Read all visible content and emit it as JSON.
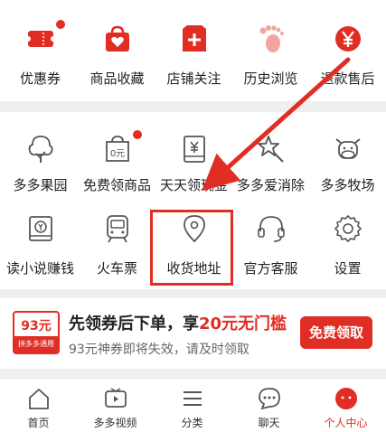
{
  "colors": {
    "brand": "#e02e24",
    "text": "#222222",
    "muted": "#666666"
  },
  "top_row": [
    {
      "label": "优惠券",
      "icon": "coupon-icon"
    },
    {
      "label": "商品收藏",
      "icon": "bag-heart-icon"
    },
    {
      "label": "店铺关注",
      "icon": "store-plus-icon"
    },
    {
      "label": "历史浏览",
      "icon": "footprint-icon"
    },
    {
      "label": "退款售后",
      "icon": "yen-circle-icon"
    }
  ],
  "grid_row1": [
    {
      "label": "多多果园",
      "icon": "tree-icon"
    },
    {
      "label": "免费领商品",
      "icon": "zero-yuan-icon"
    },
    {
      "label": "天天领现金",
      "icon": "cash-envelope-icon"
    },
    {
      "label": "多多爱消除",
      "icon": "star-wand-icon"
    },
    {
      "label": "多多牧场",
      "icon": "cow-icon"
    }
  ],
  "grid_row2": [
    {
      "label": "读小说赚钱",
      "icon": "book-coin-icon"
    },
    {
      "label": "火车票",
      "icon": "train-icon"
    },
    {
      "label": "收货地址",
      "icon": "location-pin-icon"
    },
    {
      "label": "官方客服",
      "icon": "headset-icon"
    },
    {
      "label": "设置",
      "icon": "gear-icon"
    }
  ],
  "promo": {
    "badge_amount": "93元",
    "badge_sub": "拼多多通用",
    "title_a": "先领券后下单，享",
    "title_hl": "20元无门槛",
    "subtitle": "93元神券即将失效，请及时领取",
    "button": "免费领取"
  },
  "tabs": [
    {
      "label": "首页",
      "icon": "home-icon"
    },
    {
      "label": "多多视频",
      "icon": "video-icon"
    },
    {
      "label": "分类",
      "icon": "list-icon"
    },
    {
      "label": "聊天",
      "icon": "chat-icon"
    },
    {
      "label": "个人中心",
      "icon": "profile-icon"
    }
  ]
}
